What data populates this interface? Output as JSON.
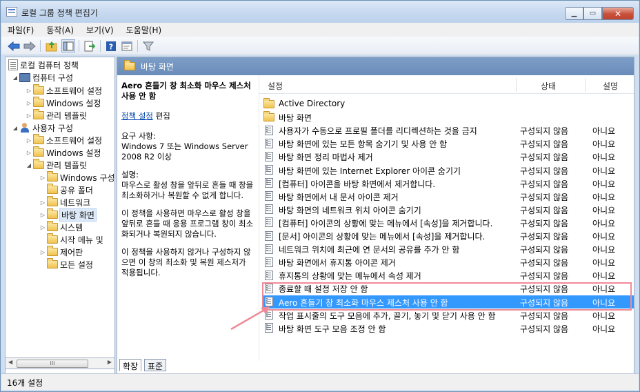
{
  "window": {
    "title": "로컬 그룹 정책 편집기"
  },
  "menu": [
    "파일(F)",
    "동작(A)",
    "보기(V)",
    "도움말(H)"
  ],
  "toolbar": {
    "buttons": [
      "back-arrow-icon",
      "forward-arrow-icon",
      "up-folder-icon",
      "show-hide-tree-icon",
      "export-list-icon",
      "help-icon",
      "properties-icon",
      "filter-icon"
    ]
  },
  "tree": [
    {
      "label": "로컬 컴퓨터 정책",
      "arrow": ""
    },
    {
      "label": "컴퓨터 구성",
      "arrow": "◢"
    },
    {
      "label": "소프트웨어 설정",
      "arrow": "▷"
    },
    {
      "label": "Windows 설정",
      "arrow": "▷"
    },
    {
      "label": "관리 템플릿",
      "arrow": "▷"
    },
    {
      "label": "사용자 구성",
      "arrow": "◢"
    },
    {
      "label": "소프트웨어 설정",
      "arrow": "▷"
    },
    {
      "label": "Windows 설정",
      "arrow": "▷"
    },
    {
      "label": "관리 템플릿",
      "arrow": "◢"
    },
    {
      "label": "Windows 구성",
      "arrow": "▷"
    },
    {
      "label": "공유 폴더",
      "arrow": ""
    },
    {
      "label": "네트워크",
      "arrow": "▷"
    },
    {
      "label": "바탕 화면",
      "arrow": "▷"
    },
    {
      "label": "시스템",
      "arrow": "▷"
    },
    {
      "label": "시작 메뉴 및",
      "arrow": ""
    },
    {
      "label": "제어판",
      "arrow": "▷"
    },
    {
      "label": "모든 설정",
      "arrow": ""
    }
  ],
  "scrollbar_thumb": "III",
  "pane_header": "바탕 화면",
  "description": {
    "title": "Aero 흔들기 창 최소화 마우스 제스처 사용 안 함",
    "edit_link": "정책 설정",
    "edit_suffix": " 편집",
    "requirements": "요구 사항:\nWindows 7 또는 Windows Server 2008 R2 이상",
    "desc": "설명:\n마우스로 활성 창을 앞뒤로 흔들 때 창을 최소화하거나 복원할 수 없게 합니다.",
    "p2": "이 정책을 사용하면 마우스로 활성 창을 앞뒤로 흔들 때 응용 프로그램 창이 최소화되거나 복원되지 않습니다.",
    "p3": "이 정책을 사용하지 않거나 구성하지 않으면 이 창의 최소화 및 복원 제스처가 적용됩니다."
  },
  "columns": {
    "setting": "설정",
    "state": "상태",
    "comment": "설명"
  },
  "rows": [
    {
      "icon": "folder-icon",
      "name": "Active Directory",
      "state": "",
      "comment": ""
    },
    {
      "icon": "folder-icon",
      "name": "바탕 화면",
      "state": "",
      "comment": ""
    },
    {
      "icon": "setting-icon",
      "name": "사용자가 수동으로 프로필 폴더를 리디렉션하는 것을 금지",
      "state": "구성되지 않음",
      "comment": "아니요"
    },
    {
      "icon": "setting-icon",
      "name": "바탕 화면에 있는 모든 항목 숨기기 및 사용 안 함",
      "state": "구성되지 않음",
      "comment": "아니요"
    },
    {
      "icon": "setting-icon",
      "name": "바탕 화면 정리 마법사 제거",
      "state": "구성되지 않음",
      "comment": "아니요"
    },
    {
      "icon": "setting-icon",
      "name": "바탕 화면에 있는 Internet Explorer 아이콘 숨기기",
      "state": "구성되지 않음",
      "comment": "아니요"
    },
    {
      "icon": "setting-icon",
      "name": "[컴퓨터] 아이콘을 바탕 화면에서 제거합니다.",
      "state": "구성되지 않음",
      "comment": "아니요"
    },
    {
      "icon": "setting-icon",
      "name": "바탕 화면에서 내 문서 아이콘 제거",
      "state": "구성되지 않음",
      "comment": "아니요"
    },
    {
      "icon": "setting-icon",
      "name": "바탕 화면의 네트워크 위치 아이콘 숨기기",
      "state": "구성되지 않음",
      "comment": "아니요"
    },
    {
      "icon": "setting-icon",
      "name": "[컴퓨터] 아이콘의 상황에 맞는 메뉴에서 [속성]을 제거합니다.",
      "state": "구성되지 않음",
      "comment": "아니요"
    },
    {
      "icon": "setting-icon",
      "name": "[문서] 아이콘의 상황에 맞는 메뉴에서 [속성]을 제거합니다.",
      "state": "구성되지 않음",
      "comment": "아니요"
    },
    {
      "icon": "setting-icon",
      "name": "네트워크 위치에 최근에 연 문서의 공유를 추가 안 함",
      "state": "구성되지 않음",
      "comment": "아니요"
    },
    {
      "icon": "setting-icon",
      "name": "바탕 화면에서 휴지통 아이콘 제거",
      "state": "구성되지 않음",
      "comment": "아니요"
    },
    {
      "icon": "setting-icon",
      "name": "휴지통의 상황에 맞는 메뉴에서 속성 제거",
      "state": "구성되지 않음",
      "comment": "아니요"
    },
    {
      "icon": "setting-icon",
      "name": "종료할 때 설정 저장 안 함",
      "state": "구성되지 않음",
      "comment": "아니요"
    },
    {
      "icon": "setting-icon",
      "name": "Aero 흔들기 창 최소화 마우스 제스처 사용 안 함",
      "state": "구성되지 않음",
      "comment": "아니요",
      "selected": true
    },
    {
      "icon": "setting-icon",
      "name": "작업 표시줄의 도구 모음에 추가, 끌기, 놓기 및 닫기 사용 안 함",
      "state": "구성되지 않음",
      "comment": "아니요"
    },
    {
      "icon": "setting-icon",
      "name": "바탕 화면 도구 모음 조정 안 함",
      "state": "구성되지 않음",
      "comment": "아니요"
    }
  ],
  "tabs": [
    "확장",
    "표준"
  ],
  "status": "16개 설정",
  "colors": {
    "selection": "#3399ff",
    "pane_header": "#7e9ec7",
    "annotation": "#f08a96"
  }
}
